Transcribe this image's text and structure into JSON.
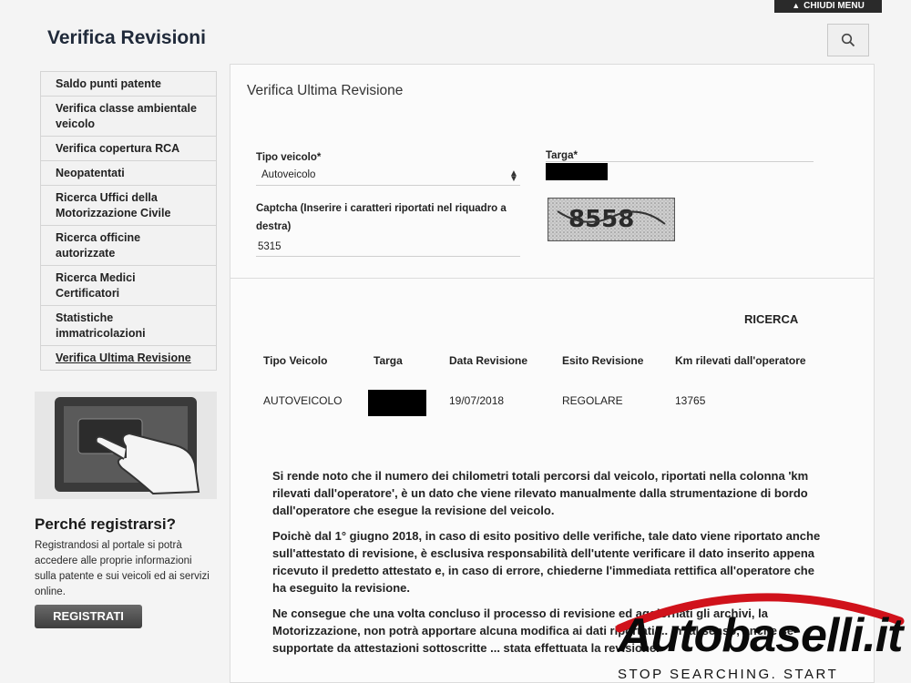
{
  "header": {
    "close_menu_label": "CHIUDI MENU",
    "page_title": "Verifica Revisioni",
    "search_icon": "search-icon"
  },
  "sidebar": {
    "items": [
      {
        "label": "Saldo punti patente"
      },
      {
        "label": "Verifica classe ambientale veicolo"
      },
      {
        "label": "Verifica copertura RCA"
      },
      {
        "label": "Neopatentati"
      },
      {
        "label": "Ricerca Uffici della Motorizzazione Civile"
      },
      {
        "label": "Ricerca officine autorizzate"
      },
      {
        "label": "Ricerca Medici Certificatori"
      },
      {
        "label": "Statistiche immatricolazioni"
      },
      {
        "label": "Verifica Ultima Revisione"
      }
    ]
  },
  "promo": {
    "title": "Perché registrarsi?",
    "text": "Registrandosi al portale si potrà accedere alle proprie informazioni sulla patente e sui veicoli ed ai servizi online.",
    "button_label": "REGISTRATI"
  },
  "form": {
    "title": "Verifica Ultima Revisione",
    "vehicle_type_label": "Tipo veicolo*",
    "vehicle_type_value": "Autoveicolo",
    "plate_label": "Targa*",
    "captcha_label": "Captcha (Inserire i caratteri riportati nel riquadro a destra)",
    "captcha_value": "5315",
    "captcha_image_text": "8558"
  },
  "results": {
    "search_label": "RICERCA",
    "columns": [
      "Tipo Veicolo",
      "Targa",
      "Data Revisione",
      "Esito Revisione",
      "Km rilevati dall'operatore"
    ],
    "row": {
      "tipo": "AUTOVEICOLO",
      "data": "19/07/2018",
      "esito": "REGOLARE",
      "km": "13765"
    }
  },
  "notes": [
    "Si rende noto che il numero dei chilometri totali percorsi dal veicolo, riportati nella colonna 'km rilevati dall'operatore', è un dato che viene rilevato manualmente dalla strumentazione di bordo dall'operatore che esegue la revisione del veicolo.",
    "Poichè dal 1° giugno 2018, in caso di esito positivo delle verifiche, tale dato viene riportato anche sull'attestato di revisione, è esclusiva responsabilità dell'utente verificare il dato inserito appena ricevuto il predetto attestato e, in caso di errore, chiederne l'immediata rettifica all'operatore che ha eseguito la revisione.",
    "Ne consegue che una volta concluso il processo di revisione ed aggiornati gli archivi, la Motorizzazione, non potrà apportare alcuna modifica ai dati riportati ... in tal senso, anche se supportate da attestazioni sottoscritte ... stata effettuata la revisione."
  ],
  "watermark": {
    "brand": "Autobaselli.it",
    "tagline": "STOP SEARCHING. START DRIVING."
  },
  "colors": {
    "accent_red": "#d0121b",
    "button_dark": "#4a4a4a"
  }
}
